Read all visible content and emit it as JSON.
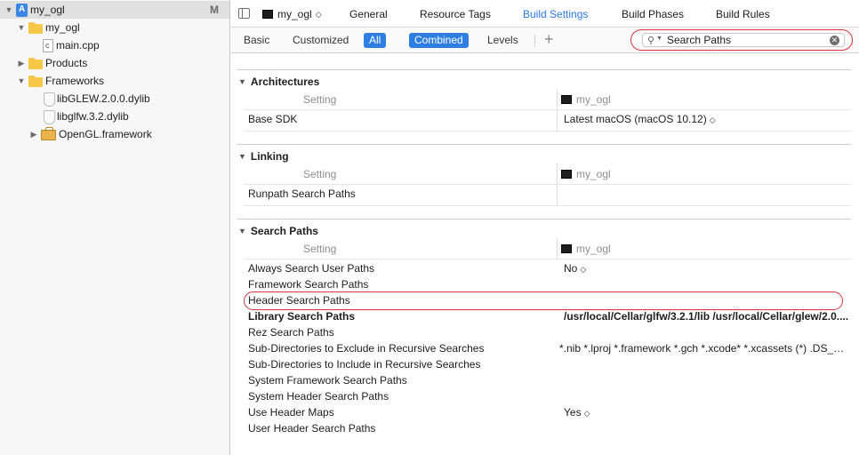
{
  "navigator": {
    "items": [
      {
        "label": "my_ogl",
        "badge": "M",
        "icon": "project-icon"
      },
      {
        "label": "my_ogl",
        "icon": "folder-icon"
      },
      {
        "label": "main.cpp",
        "icon": "cpp-file-icon"
      },
      {
        "label": "Products",
        "icon": "folder-icon"
      },
      {
        "label": "Frameworks",
        "icon": "folder-icon"
      },
      {
        "label": "libGLEW.2.0.0.dylib",
        "icon": "dylib-icon"
      },
      {
        "label": "libglfw.3.2.dylib",
        "icon": "dylib-icon"
      },
      {
        "label": "OpenGL.framework",
        "icon": "framework-icon"
      }
    ]
  },
  "tabbar": {
    "target": "my_ogl",
    "tabs": [
      "General",
      "Resource Tags",
      "Build Settings",
      "Build Phases",
      "Build Rules"
    ],
    "active_tab": "Build Settings"
  },
  "filterbar": {
    "basic": "Basic",
    "customized": "Customized",
    "all": "All",
    "combined": "Combined",
    "levels": "Levels",
    "plus": "+",
    "search_value": "Search Paths"
  },
  "sections": {
    "architectures": {
      "title": "Architectures",
      "col_setting": "Setting",
      "col_target": "my_ogl",
      "rows": [
        {
          "name": "Base SDK",
          "value": "Latest macOS (macOS 10.12)",
          "popup": true
        }
      ]
    },
    "linking": {
      "title": "Linking",
      "col_setting": "Setting",
      "col_target": "my_ogl",
      "rows": [
        {
          "name": "Runpath Search Paths",
          "value": ""
        }
      ]
    },
    "search_paths": {
      "title": "Search Paths",
      "col_setting": "Setting",
      "col_target": "my_ogl",
      "rows": [
        {
          "name": "Always Search User Paths",
          "value": "No"
        },
        {
          "name": "Framework Search Paths",
          "value": ""
        },
        {
          "name": "Header Search Paths",
          "value": ""
        },
        {
          "name": "Library Search Paths",
          "value": "/usr/local/Cellar/glfw/3.2.1/lib /usr/local/Cellar/glew/2.0...."
        },
        {
          "name": "Rez Search Paths",
          "value": ""
        },
        {
          "name": "Sub-Directories to Exclude in Recursive Searches",
          "value": "*.nib *.lproj *.framework *.gch *.xcode* *.xcassets (*) .DS_Sto..."
        },
        {
          "name": "Sub-Directories to Include in Recursive Searches",
          "value": ""
        },
        {
          "name": "System Framework Search Paths",
          "value": ""
        },
        {
          "name": "System Header Search Paths",
          "value": ""
        },
        {
          "name": "Use Header Maps",
          "value": "Yes"
        },
        {
          "name": "User Header Search Paths",
          "value": ""
        }
      ]
    }
  },
  "colors": {
    "accent": "#2f7fe3",
    "annotation_ring": "#d9363e"
  }
}
